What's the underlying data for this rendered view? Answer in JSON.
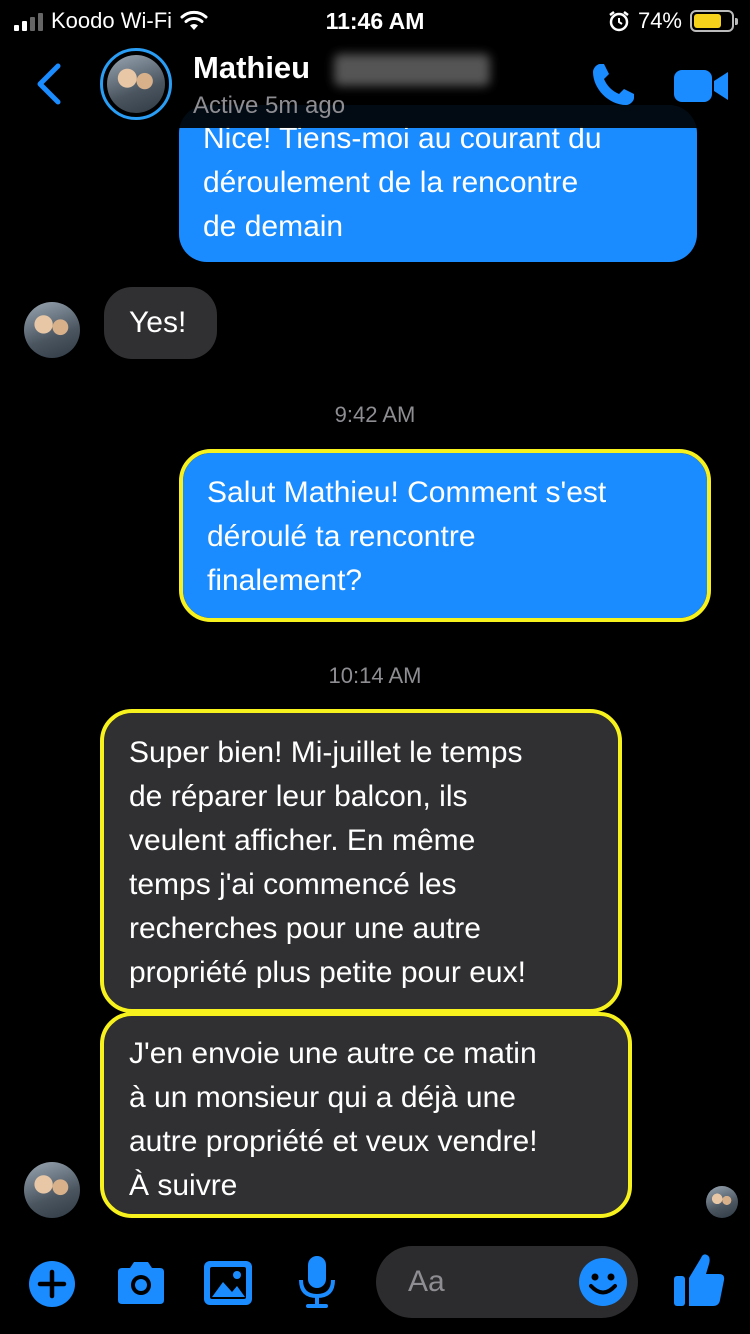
{
  "status_bar": {
    "carrier": "Koodo Wi-Fi",
    "time": "11:46 AM",
    "battery_percent": "74%",
    "battery_level": 0.74
  },
  "header": {
    "contact_name": "Mathieu",
    "status": "Active 5m ago",
    "accent_color": "#1a8cff"
  },
  "messages": [
    {
      "direction": "outgoing",
      "lines": [
        "Nice! Tiens-moi au courant du",
        "déroulement de la rencontre",
        "de demain"
      ]
    },
    {
      "direction": "incoming",
      "lines": [
        "Yes!"
      ]
    },
    {
      "type": "timestamp",
      "text": "9:42 AM"
    },
    {
      "direction": "outgoing",
      "highlighted": true,
      "lines": [
        "Salut Mathieu! Comment s'est",
        "déroulé ta rencontre",
        "finalement?"
      ]
    },
    {
      "type": "timestamp",
      "text": "10:14 AM"
    },
    {
      "direction": "incoming",
      "highlighted": true,
      "lines": [
        "Super bien! Mi-juillet le temps",
        "de réparer leur balcon, ils",
        "veulent afficher. En même",
        "temps j'ai commencé les",
        "recherches pour une autre",
        "propriété plus petite pour eux!"
      ]
    },
    {
      "direction": "incoming",
      "highlighted": true,
      "lines": [
        "J'en envoie une autre ce matin",
        "à un monsieur qui a déjà une",
        "autre propriété et veux vendre!",
        "À suivre"
      ]
    }
  ],
  "composer": {
    "placeholder": "Aa",
    "icons": [
      "plus-icon",
      "camera-icon",
      "image-icon",
      "microphone-icon",
      "emoji-icon",
      "thumbs-up-icon"
    ]
  }
}
